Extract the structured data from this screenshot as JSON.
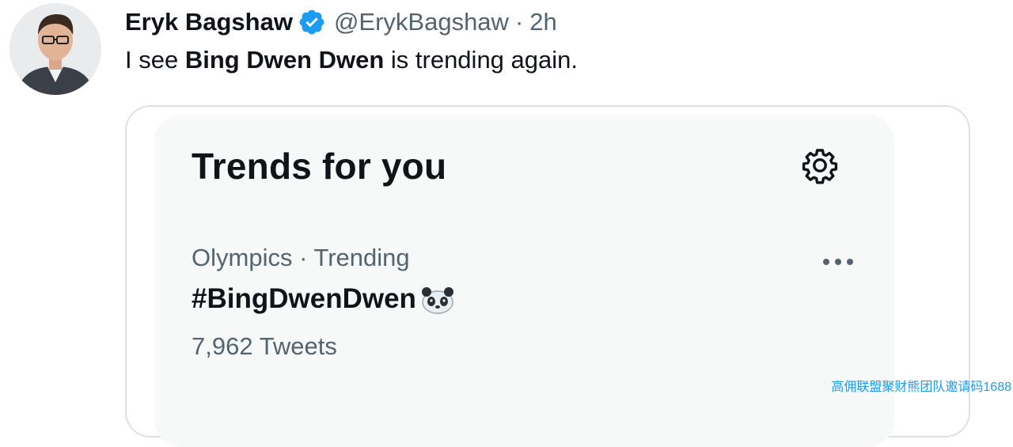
{
  "tweet": {
    "display_name": "Eryk Bagshaw",
    "handle": "@ErykBagshaw",
    "separator": "·",
    "time": "2h",
    "text_before": "I see ",
    "text_bold": "Bing Dwen Dwen",
    "text_after": " is trending again."
  },
  "trends_card": {
    "title": "Trends for you",
    "trend": {
      "meta": "Olympics · Trending",
      "hashtag": "#BingDwenDwen",
      "count": "7,962 Tweets"
    }
  },
  "watermark": "高佣联盟聚财熊团队邀请码1688",
  "icons": {
    "verified": "verified-badge-icon",
    "settings": "gear-icon",
    "more": "more-horizontal-icon",
    "panda": "panda-emoji-icon"
  },
  "colors": {
    "verified": "#1d9bf0",
    "secondary_text": "#536471",
    "panel_bg": "#f7f8f8",
    "card_border": "#dde1e4"
  }
}
